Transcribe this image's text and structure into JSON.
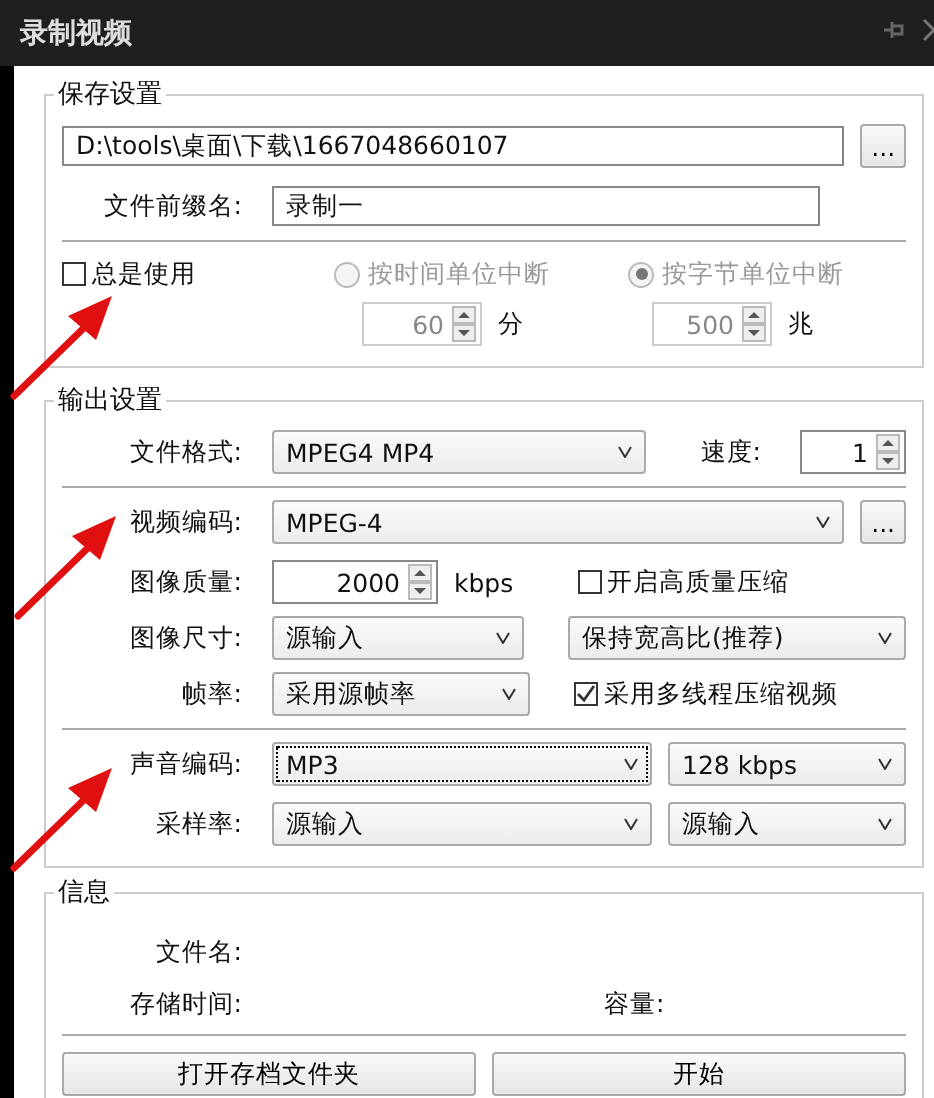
{
  "window": {
    "title": "录制视频"
  },
  "save_settings": {
    "title": "保存设置",
    "path": {
      "value": "D:\\tools\\桌面\\下载\\1667048660107",
      "button": "..."
    },
    "prefix": {
      "label": "文件前缀名:",
      "value": "录制一"
    },
    "always_use": {
      "label": "总是使用",
      "checked": false
    },
    "split_options": [
      {
        "label": "按时间单位中断",
        "selected": false,
        "disabled": true,
        "value": "60",
        "unit": "分"
      },
      {
        "label": "按字节单位中断",
        "selected": true,
        "disabled": true,
        "value": "500",
        "unit": "兆"
      }
    ]
  },
  "output_settings": {
    "title": "输出设置",
    "format": {
      "label": "文件格式:",
      "value": "MPEG4 MP4"
    },
    "speed": {
      "label": "速度:",
      "value": "1"
    },
    "video_codec": {
      "label": "视频编码:",
      "value": "MPEG-4",
      "button": "..."
    },
    "quality": {
      "label": "图像质量:",
      "value": "2000",
      "unit": "kbps"
    },
    "high_quality": {
      "label": "开启高质量压缩",
      "checked": false
    },
    "size": {
      "label": "图像尺寸:",
      "value": "源输入",
      "aspect": "保持宽高比(推荐)"
    },
    "frame_rate": {
      "label": "帧率:",
      "value": "采用源帧率"
    },
    "multithread": {
      "label": "采用多线程压缩视频",
      "checked": true
    },
    "audio_codec": {
      "label": "声音编码:",
      "value": "MP3",
      "focused": true,
      "bitrate": "128 kbps"
    },
    "sample_rate": {
      "label": "采样率:",
      "value": "源输入",
      "channels": "源输入"
    }
  },
  "info": {
    "title": "信息",
    "file_name": {
      "label": "文件名:"
    },
    "duration": {
      "label": "存储时间:"
    },
    "size": {
      "label": "容量:"
    },
    "buttons": [
      {
        "label": "打开存档文件夹"
      },
      {
        "label": "开始"
      }
    ]
  }
}
